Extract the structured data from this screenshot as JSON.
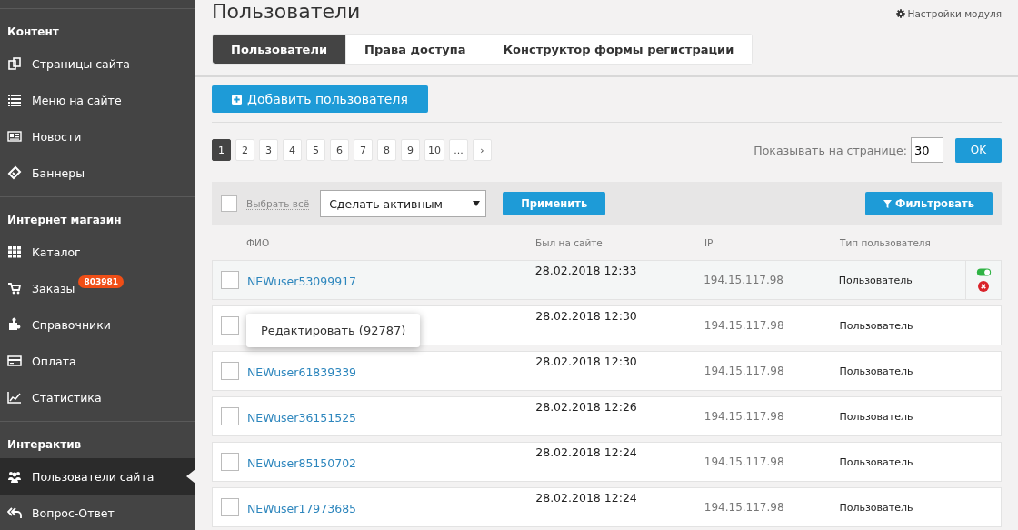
{
  "sidebar": {
    "sections": [
      {
        "title": "Контент",
        "items": [
          {
            "label": "Страницы сайта",
            "selected": false
          },
          {
            "label": "Меню на сайте",
            "selected": false
          },
          {
            "label": "Новости",
            "selected": false
          },
          {
            "label": "Баннеры",
            "selected": false
          }
        ]
      },
      {
        "title": "Интернет магазин",
        "items": [
          {
            "label": "Каталог",
            "selected": false
          },
          {
            "label": "Заказы",
            "badge": "803981",
            "selected": false
          },
          {
            "label": "Справочники",
            "selected": false
          },
          {
            "label": "Оплата",
            "selected": false
          },
          {
            "label": "Статистика",
            "selected": false
          }
        ]
      },
      {
        "title": "Интерактив",
        "items": [
          {
            "label": "Пользователи сайта",
            "selected": true
          },
          {
            "label": "Вопрос-Ответ",
            "selected": false
          }
        ]
      }
    ]
  },
  "page": {
    "title": "Пользователи",
    "settings_link": "Настройки модуля"
  },
  "tabs": [
    {
      "label": "Пользователи",
      "selected": true
    },
    {
      "label": "Права доступа",
      "selected": false
    },
    {
      "label": "Конструктор формы регистрации",
      "selected": false
    }
  ],
  "add_button": "Добавить пользователя",
  "pagination": {
    "pages": [
      {
        "label": "1",
        "selected": true
      },
      {
        "label": "2",
        "selected": false
      },
      {
        "label": "3",
        "selected": false
      },
      {
        "label": "4",
        "selected": false
      },
      {
        "label": "5",
        "selected": false
      },
      {
        "label": "6",
        "selected": false
      },
      {
        "label": "7",
        "selected": false
      },
      {
        "label": "8",
        "selected": false
      },
      {
        "label": "9",
        "selected": false
      },
      {
        "label": "10",
        "selected": false
      },
      {
        "label": "...",
        "selected": false
      },
      {
        "label": "›",
        "selected": false
      }
    ],
    "per_page_label": "Показывать на странице:",
    "per_page_value": "30",
    "ok_button": "OK"
  },
  "toolbar": {
    "select_all": "Выбрать всё",
    "select_all_checked": false,
    "action_value": "Сделать активным",
    "apply_button": "Применить",
    "filter_button": "Фильтровать"
  },
  "table": {
    "columns": [
      "ФИО",
      "Был на сайте",
      "IP",
      "Тип пользователя"
    ],
    "rows": [
      {
        "name": "NEWuser53099917",
        "last_seen": "28.02.2018 12:33",
        "ip": "194.15.117.98",
        "type": "Пользователь",
        "checked": false,
        "hovered": true,
        "active": true
      },
      {
        "last_seen": "28.02.2018 12:30",
        "ip": "194.15.117.98",
        "type": "Пользователь",
        "checked": false,
        "hovered": false
      },
      {
        "name": "NEWuser61839339",
        "last_seen": "28.02.2018 12:30",
        "ip": "194.15.117.98",
        "type": "Пользователь",
        "checked": false,
        "hovered": false
      },
      {
        "name": "NEWuser36151525",
        "last_seen": "28.02.2018 12:26",
        "ip": "194.15.117.98",
        "type": "Пользователь",
        "checked": false,
        "hovered": false
      },
      {
        "name": "NEWuser85150702",
        "last_seen": "28.02.2018 12:24",
        "ip": "194.15.117.98",
        "type": "Пользователь",
        "checked": false,
        "hovered": false
      },
      {
        "name": "NEWuser17973685",
        "last_seen": "28.02.2018 12:24",
        "ip": "194.15.117.98",
        "type": "Пользователь",
        "checked": false,
        "hovered": false
      }
    ]
  },
  "tooltip": {
    "text": "Редактировать (92787)"
  }
}
